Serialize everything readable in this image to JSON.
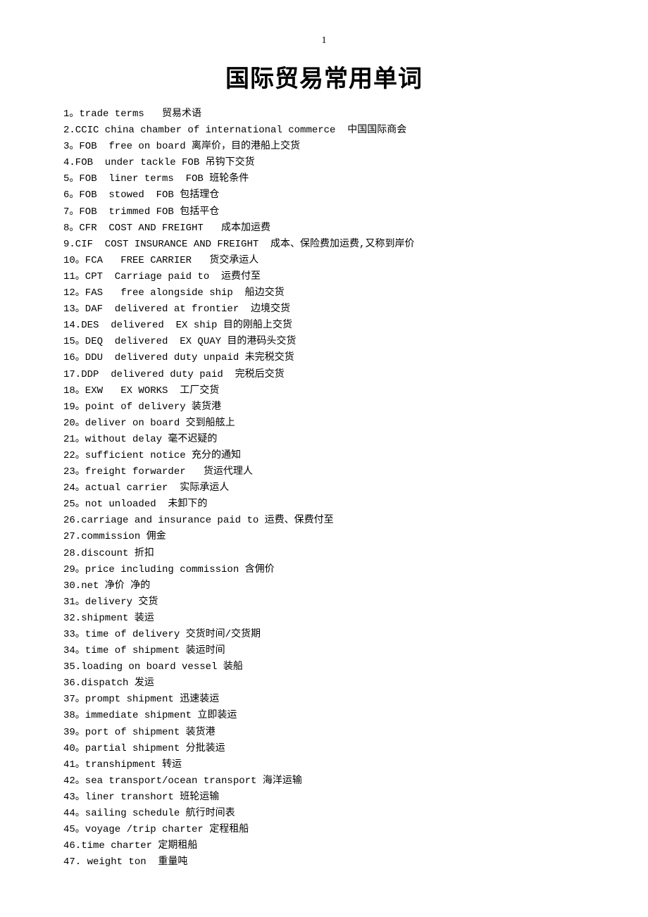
{
  "page_number": "1",
  "title": "国际贸易常用单词",
  "entries": [
    "1。trade terms   贸易术语",
    "2.CCIC china chamber of international commerce  中国国际商会",
    "3。FOB  free on board 离岸价，目的港船上交货",
    "4.FOB  under tackle FOB 吊钩下交货",
    "5。FOB  liner terms  FOB 班轮条件",
    "6。FOB  stowed  FOB 包括理仓",
    "7。FOB  trimmed FOB 包括平仓",
    "8。CFR  COST AND FREIGHT   成本加运费",
    "9.CIF  COST INSURANCE AND FREIGHT  成本、保险费加运费,又称到岸价",
    "10。FCA   FREE CARRIER   货交承运人",
    "11。CPT  Carriage paid to  运费付至",
    "12。FAS   free alongside ship  船边交货",
    "13。DAF  delivered at frontier  边境交货",
    "14.DES  delivered  EX ship 目的刚船上交货",
    "15。DEQ  delivered  EX QUAY 目的港码头交货",
    "16。DDU  delivered duty unpaid 未完税交货",
    "17.DDP  delivered duty paid  完税后交货",
    "18。EXW   EX WORKS  工厂交货",
    "19。point of delivery 装货港",
    "20。deliver on board 交到船舷上",
    "21。without delay 毫不迟疑的",
    "22。sufficient notice 充分的通知",
    "23。freight forwarder   货运代理人",
    "24。actual carrier  实际承运人",
    "25。not unloaded  未卸下的",
    "26.carriage and insurance paid to 运费、保费付至",
    "27.commission 佣金",
    "28.discount 折扣",
    "29。price including commission 含佣价",
    "30.net 净价 净的",
    "31。delivery 交货",
    "32.shipment 装运",
    "33。time of delivery 交货时间/交货期",
    "34。time of shipment 装运时间",
    "35.loading on board vessel 装船",
    "36.dispatch 发运",
    "37。prompt shipment 迅速装运",
    "38。immediate shipment 立即装运",
    "39。port of shipment 装货港",
    "40。partial shipment 分批装运",
    "41。transhipment 转运",
    "42。sea transport/ocean transport 海洋运输",
    "43。liner transhort 班轮运输",
    "44。sailing schedule 航行时间表",
    "45。voyage /trip charter 定程租船",
    "46.time charter 定期租船",
    "47. weight ton  重量吨"
  ]
}
